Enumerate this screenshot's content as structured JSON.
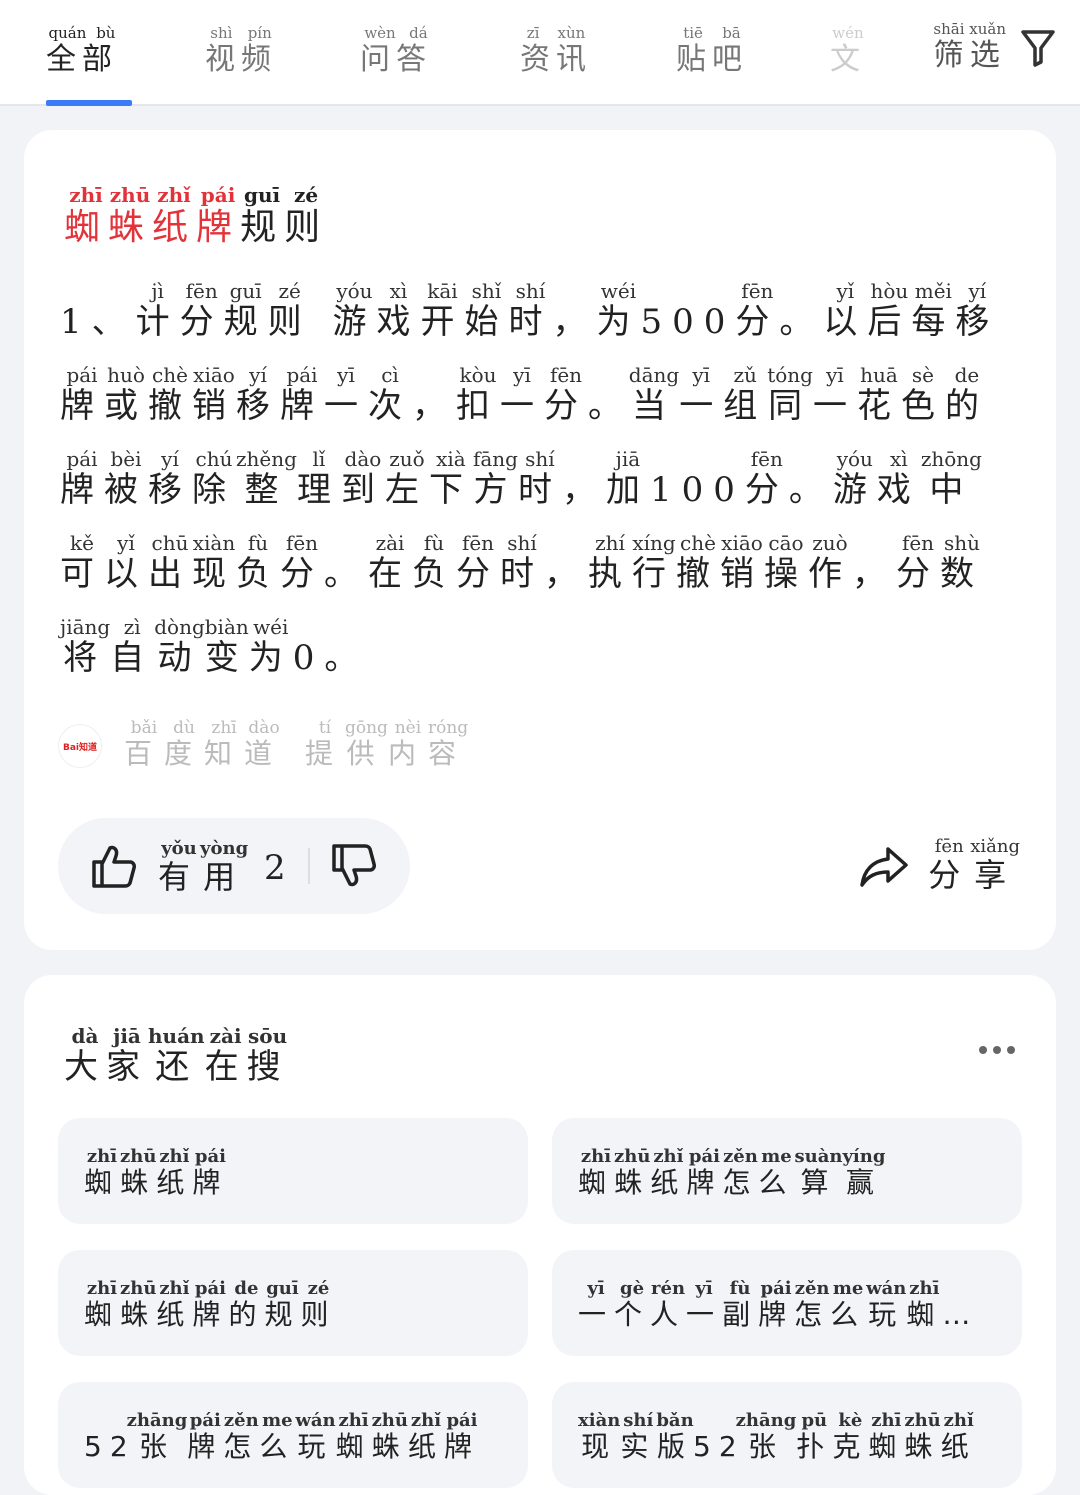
{
  "tabs": [
    {
      "label": "全部",
      "pinyin": "quán bù"
    },
    {
      "label": "视频",
      "pinyin": "shì pín"
    },
    {
      "label": "问答",
      "pinyin": "wèn dá"
    },
    {
      "label": "资讯",
      "pinyin": "zī xùn"
    },
    {
      "label": "贴吧",
      "pinyin": "tiē bā"
    },
    {
      "label": "文",
      "pinyin": "wén"
    }
  ],
  "filter": {
    "label": "筛选",
    "pinyin": "shāi xuǎn"
  },
  "accent_color": "#3b7cf5",
  "highlight_color": "#e2333a",
  "answer": {
    "title_highlight": [
      {
        "c": "蜘",
        "p": "zhī"
      },
      {
        "c": "蛛",
        "p": "zhū"
      },
      {
        "c": "纸",
        "p": "zhǐ"
      },
      {
        "c": "牌",
        "p": "pái"
      }
    ],
    "title_rest": [
      {
        "c": "规",
        "p": "guī"
      },
      {
        "c": "则",
        "p": "zé"
      }
    ],
    "body": [
      {
        "c": "1、",
        "p": ""
      },
      {
        "c": "计",
        "p": "jì"
      },
      {
        "c": "分",
        "p": "fēn"
      },
      {
        "c": "规",
        "p": "guī"
      },
      {
        "c": "则",
        "p": "zé"
      },
      {
        "c": " ",
        "p": ""
      },
      {
        "c": "游",
        "p": "yóu"
      },
      {
        "c": "戏",
        "p": "xì"
      },
      {
        "c": "开",
        "p": "kāi"
      },
      {
        "c": "始",
        "p": "shǐ"
      },
      {
        "c": "时",
        "p": "shí"
      },
      {
        "c": "，",
        "p": ""
      },
      {
        "c": "为",
        "p": "wéi"
      },
      {
        "c": "500",
        "p": ""
      },
      {
        "c": "分",
        "p": "fēn"
      },
      {
        "c": "。",
        "p": ""
      },
      {
        "c": "以",
        "p": "yǐ"
      },
      {
        "c": "后",
        "p": "hòu"
      },
      {
        "c": "每",
        "p": "měi"
      },
      {
        "c": "移",
        "p": "yí"
      },
      {
        "c": "牌",
        "p": "pái"
      },
      {
        "c": "或",
        "p": "huò"
      },
      {
        "c": "撤",
        "p": "chè"
      },
      {
        "c": "销",
        "p": "xiāo"
      },
      {
        "c": "移",
        "p": "yí"
      },
      {
        "c": "牌",
        "p": "pái"
      },
      {
        "c": "一",
        "p": "yī"
      },
      {
        "c": "次",
        "p": "cì"
      },
      {
        "c": "，",
        "p": ""
      },
      {
        "c": "扣",
        "p": "kòu"
      },
      {
        "c": "一",
        "p": "yī"
      },
      {
        "c": "分",
        "p": "fēn"
      },
      {
        "c": "。",
        "p": ""
      },
      {
        "c": "当",
        "p": "dāng"
      },
      {
        "c": "一",
        "p": "yī"
      },
      {
        "c": "组",
        "p": "zǔ"
      },
      {
        "c": "同",
        "p": "tóng"
      },
      {
        "c": "一",
        "p": "yī"
      },
      {
        "c": "花",
        "p": "huā"
      },
      {
        "c": "色",
        "p": "sè"
      },
      {
        "c": "的",
        "p": "de"
      },
      {
        "c": "牌",
        "p": "pái"
      },
      {
        "c": "被",
        "p": "bèi"
      },
      {
        "c": "移",
        "p": "yí"
      },
      {
        "c": "除",
        "p": "chú"
      },
      {
        "c": "整",
        "p": "zhěng"
      },
      {
        "c": "理",
        "p": "lǐ"
      },
      {
        "c": "到",
        "p": "dào"
      },
      {
        "c": "左",
        "p": "zuǒ"
      },
      {
        "c": "下",
        "p": "xià"
      },
      {
        "c": "方",
        "p": "fāng"
      },
      {
        "c": "时",
        "p": "shí"
      },
      {
        "c": "，",
        "p": ""
      },
      {
        "c": "加",
        "p": "jiā"
      },
      {
        "c": "100",
        "p": ""
      },
      {
        "c": "分",
        "p": "fēn"
      },
      {
        "c": "。",
        "p": ""
      },
      {
        "c": "游",
        "p": "yóu"
      },
      {
        "c": "戏",
        "p": "xì"
      },
      {
        "c": "中",
        "p": "zhōng"
      },
      {
        "c": "可",
        "p": "kě"
      },
      {
        "c": "以",
        "p": "yǐ"
      },
      {
        "c": "出",
        "p": "chū"
      },
      {
        "c": "现",
        "p": "xiàn"
      },
      {
        "c": "负",
        "p": "fù"
      },
      {
        "c": "分",
        "p": "fēn"
      },
      {
        "c": "。",
        "p": ""
      },
      {
        "c": "在",
        "p": "zài"
      },
      {
        "c": "负",
        "p": "fù"
      },
      {
        "c": "分",
        "p": "fēn"
      },
      {
        "c": "时",
        "p": "shí"
      },
      {
        "c": "，",
        "p": ""
      },
      {
        "c": "执",
        "p": "zhí"
      },
      {
        "c": "行",
        "p": "xíng"
      },
      {
        "c": "撤",
        "p": "chè"
      },
      {
        "c": "销",
        "p": "xiāo"
      },
      {
        "c": "操",
        "p": "cāo"
      },
      {
        "c": "作",
        "p": "zuò"
      },
      {
        "c": "，",
        "p": ""
      },
      {
        "c": "分",
        "p": "fēn"
      },
      {
        "c": "数",
        "p": "shù"
      },
      {
        "c": "将",
        "p": "jiāng"
      },
      {
        "c": "自",
        "p": "zì"
      },
      {
        "c": "动",
        "p": "dòng"
      },
      {
        "c": "变",
        "p": "biàn"
      },
      {
        "c": "为",
        "p": "wéi"
      },
      {
        "c": "0",
        "p": ""
      },
      {
        "c": "。",
        "p": ""
      }
    ],
    "source": [
      {
        "c": "百",
        "p": "bǎi"
      },
      {
        "c": "度",
        "p": "dù"
      },
      {
        "c": "知",
        "p": "zhī"
      },
      {
        "c": "道",
        "p": "dào"
      },
      {
        "c": " ",
        "p": ""
      },
      {
        "c": "提",
        "p": "tí"
      },
      {
        "c": "供",
        "p": "gōng"
      },
      {
        "c": "内",
        "p": "nèi"
      },
      {
        "c": "容",
        "p": "róng"
      }
    ],
    "source_logo_text": "Bai知道",
    "useful": [
      {
        "c": "有",
        "p": "yǒu"
      },
      {
        "c": "用",
        "p": "yòng"
      }
    ],
    "useful_count": "2",
    "share": [
      {
        "c": "分",
        "p": "fēn"
      },
      {
        "c": "享",
        "p": "xiǎng"
      }
    ]
  },
  "related": {
    "title": [
      {
        "c": "大",
        "p": "dà"
      },
      {
        "c": "家",
        "p": "jiā"
      },
      {
        "c": "还",
        "p": "huán"
      },
      {
        "c": "在",
        "p": "zài"
      },
      {
        "c": "搜",
        "p": "sōu"
      }
    ],
    "items": [
      [
        {
          "c": "蜘",
          "p": "zhī"
        },
        {
          "c": "蛛",
          "p": "zhū"
        },
        {
          "c": "纸",
          "p": "zhǐ"
        },
        {
          "c": "牌",
          "p": "pái"
        }
      ],
      [
        {
          "c": "蜘",
          "p": "zhī"
        },
        {
          "c": "蛛",
          "p": "zhū"
        },
        {
          "c": "纸",
          "p": "zhǐ"
        },
        {
          "c": "牌",
          "p": "pái"
        },
        {
          "c": "怎",
          "p": "zěn"
        },
        {
          "c": "么",
          "p": "me"
        },
        {
          "c": "算",
          "p": "suàn"
        },
        {
          "c": "赢",
          "p": "yíng"
        }
      ],
      [
        {
          "c": "蜘",
          "p": "zhī"
        },
        {
          "c": "蛛",
          "p": "zhū"
        },
        {
          "c": "纸",
          "p": "zhǐ"
        },
        {
          "c": "牌",
          "p": "pái"
        },
        {
          "c": "的",
          "p": "de"
        },
        {
          "c": "规",
          "p": "guī"
        },
        {
          "c": "则",
          "p": "zé"
        }
      ],
      [
        {
          "c": "一",
          "p": "yī"
        },
        {
          "c": "个",
          "p": "gè"
        },
        {
          "c": "人",
          "p": "rén"
        },
        {
          "c": "一",
          "p": "yī"
        },
        {
          "c": "副",
          "p": "fù"
        },
        {
          "c": "牌",
          "p": "pái"
        },
        {
          "c": "怎",
          "p": "zěn"
        },
        {
          "c": "么",
          "p": "me"
        },
        {
          "c": "玩",
          "p": "wán"
        },
        {
          "c": "蜘",
          "p": "zhī"
        },
        {
          "c": "…",
          "p": ""
        }
      ],
      [
        {
          "c": "52",
          "p": ""
        },
        {
          "c": "张",
          "p": "zhāng"
        },
        {
          "c": "牌",
          "p": "pái"
        },
        {
          "c": "怎",
          "p": "zěn"
        },
        {
          "c": "么",
          "p": "me"
        },
        {
          "c": "玩",
          "p": "wán"
        },
        {
          "c": "蜘",
          "p": "zhī"
        },
        {
          "c": "蛛",
          "p": "zhū"
        },
        {
          "c": "纸",
          "p": "zhǐ"
        },
        {
          "c": "牌",
          "p": "pái"
        }
      ],
      [
        {
          "c": "现",
          "p": "xiàn"
        },
        {
          "c": "实",
          "p": "shí"
        },
        {
          "c": "版",
          "p": "bǎn"
        },
        {
          "c": "52",
          "p": ""
        },
        {
          "c": "张",
          "p": "zhāng"
        },
        {
          "c": "扑",
          "p": "pū"
        },
        {
          "c": "克",
          "p": "kè"
        },
        {
          "c": "蜘",
          "p": "zhī"
        },
        {
          "c": "蛛",
          "p": "zhū"
        },
        {
          "c": "纸",
          "p": "zhǐ"
        }
      ]
    ]
  }
}
